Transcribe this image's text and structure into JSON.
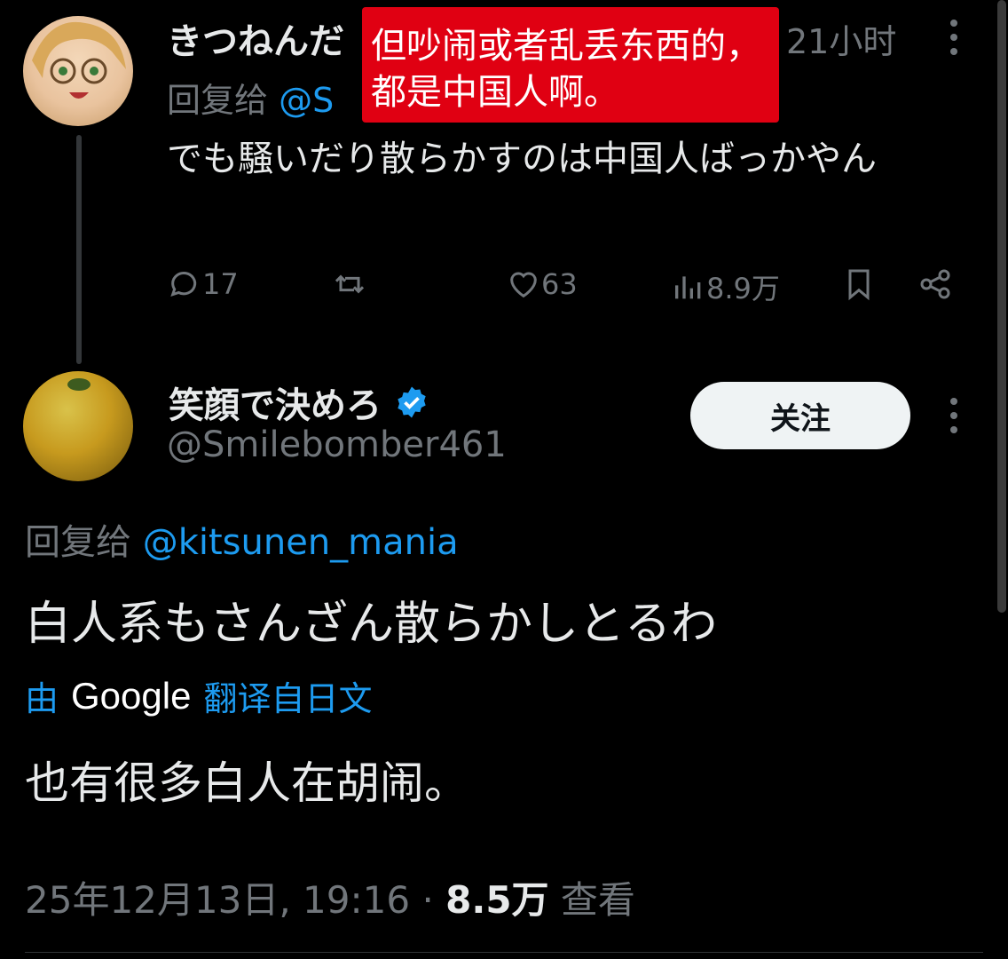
{
  "reply_tweet": {
    "display_name": "きつねんだ",
    "time_ago": "21小时",
    "reply_prefix": "回复给",
    "reply_handle": "@S",
    "text": "でも騒いだり散らかすのは中国人ばっかやん",
    "actions": {
      "replies": "17",
      "likes": "63",
      "views": "8.9万"
    }
  },
  "overlay_annotation": {
    "text": "但吵闹或者乱丢东西的，都是中国人啊。",
    "color": "#e00012"
  },
  "main_tweet": {
    "display_name": "笑顔で決めろ",
    "handle": "@Smilebomber461",
    "follow_label": "关注",
    "reply_prefix": "回复给",
    "reply_handle": "@kitsunen_mania",
    "text": "白人系もさんざん散らかしとるわ",
    "translated_by_prefix": "由",
    "translated_by_brand": "Google",
    "translated_from": "翻译自日文",
    "translation": "也有很多白人在胡闹。",
    "timestamp": "25年12月13日, 19:16",
    "separator": "·",
    "views_count": "8.5万",
    "views_label": "查看"
  },
  "colors": {
    "background": "#000000",
    "text": "#e7e9ea",
    "secondary": "#71767b",
    "accent": "#1d9bf0"
  },
  "icons": [
    "reply-icon",
    "retweet-icon",
    "like-icon",
    "views-icon",
    "bookmark-icon",
    "share-icon",
    "verified-badge-icon",
    "more-icon"
  ]
}
